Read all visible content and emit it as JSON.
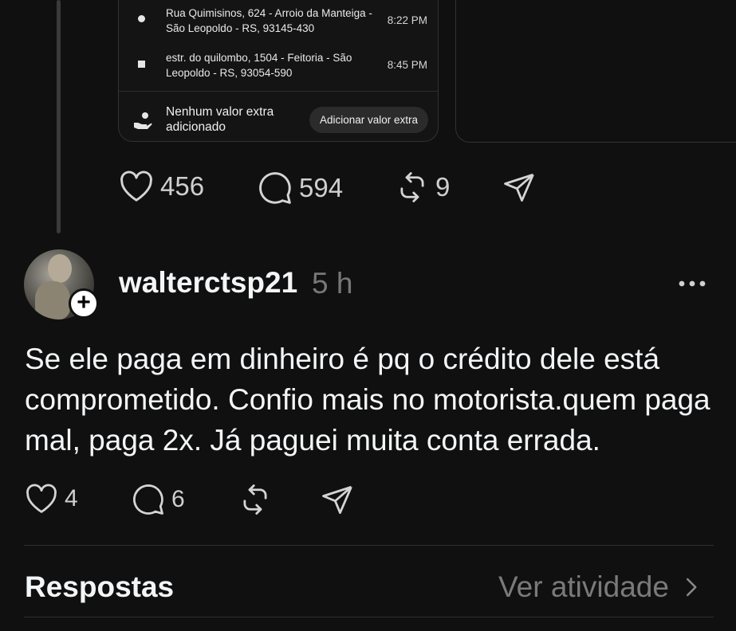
{
  "embed": {
    "routes": [
      {
        "address": "Rua Quimisinos, 624 - Arroio da Manteiga - São Leopoldo - RS, 93145-430",
        "time": "8:22 PM",
        "marker": "dot"
      },
      {
        "address": "estr. do quilombo, 1504 - Feitoria - São Leopoldo - RS, 93054-590",
        "time": "8:45 PM",
        "marker": "square"
      }
    ],
    "extra_value_text": "Nenhum valor extra adicionado",
    "extra_value_button": "Adicionar valor extra"
  },
  "parent_actions": {
    "likes": "456",
    "comments": "594",
    "reposts": "9"
  },
  "post": {
    "username": "walterctsp21",
    "timestamp": "5 h",
    "body": "Se ele paga em dinheiro é pq o crédito dele está comprometido. Confio mais no motorista.quem paga mal, paga 2x. Já paguei muita conta errada.",
    "likes": "4",
    "comments": "6"
  },
  "replies_section": {
    "title": "Respostas",
    "activity_link": "Ver atividade"
  },
  "icons": [
    "heart-icon",
    "comment-icon",
    "repost-icon",
    "share-icon",
    "more-icon",
    "chevron-right-icon",
    "plus-icon",
    "hand-coin-icon"
  ],
  "colors": {
    "background": "#101010",
    "text": "#f3f5f7",
    "muted": "#777777",
    "divider": "#2f2f2f"
  }
}
